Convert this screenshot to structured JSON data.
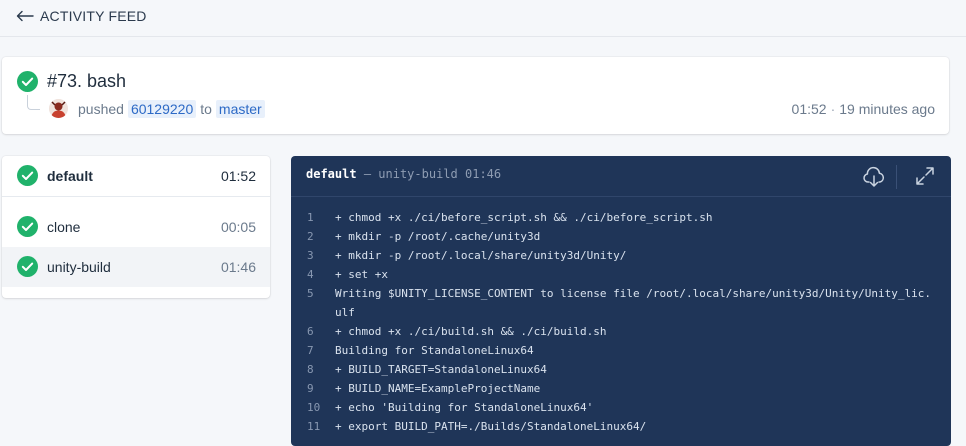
{
  "nav": {
    "back_label": "ACTIVITY FEED"
  },
  "build": {
    "title": "#73. bash",
    "action": "pushed",
    "commit": "60129220",
    "to_word": "to",
    "branch": "master",
    "duration": "01:52",
    "separator": "·",
    "time_ago": "19 minutes ago",
    "status": "success"
  },
  "colors": {
    "success": "#20b26b",
    "log_bg": "#1f3558",
    "chip_bg": "#e8f0fb",
    "chip_text": "#2d6ac6"
  },
  "stage": {
    "name": "default",
    "duration": "01:52"
  },
  "steps": [
    {
      "name": "clone",
      "duration": "00:05",
      "selected": false
    },
    {
      "name": "unity-build",
      "duration": "01:46",
      "selected": true
    }
  ],
  "log": {
    "stage": "default",
    "dash": "—",
    "step": "unity-build",
    "duration": "01:46",
    "lines": [
      {
        "n": "1",
        "text": "+ chmod +x ./ci/before_script.sh && ./ci/before_script.sh"
      },
      {
        "n": "2",
        "text": "+ mkdir -p /root/.cache/unity3d"
      },
      {
        "n": "3",
        "text": "+ mkdir -p /root/.local/share/unity3d/Unity/"
      },
      {
        "n": "4",
        "text": "+ set +x"
      },
      {
        "n": "5",
        "text": "Writing $UNITY_LICENSE_CONTENT to license file /root/.local/share/unity3d/Unity/Unity_lic.ulf"
      },
      {
        "n": "6",
        "text": "+ chmod +x ./ci/build.sh && ./ci/build.sh"
      },
      {
        "n": "7",
        "text": "Building for StandaloneLinux64"
      },
      {
        "n": "8",
        "text": "+ BUILD_TARGET=StandaloneLinux64"
      },
      {
        "n": "9",
        "text": "+ BUILD_NAME=ExampleProjectName"
      },
      {
        "n": "10",
        "text": "+ echo 'Building for StandaloneLinux64'"
      },
      {
        "n": "11",
        "text": "+ export BUILD_PATH=./Builds/StandaloneLinux64/"
      }
    ],
    "icons": {
      "download": "cloud-download-icon",
      "expand": "expand-icon"
    }
  }
}
